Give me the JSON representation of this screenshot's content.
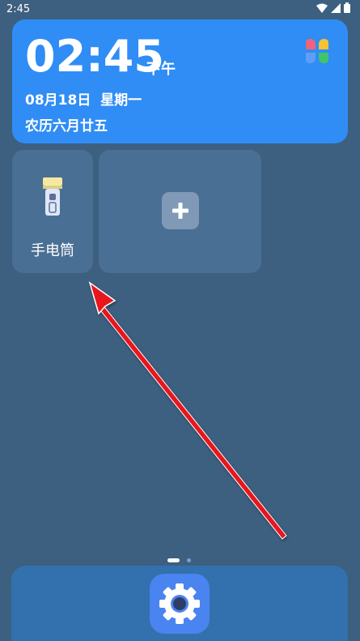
{
  "status_bar": {
    "time": "2:45",
    "icons": [
      "wifi-icon",
      "signal-icon",
      "battery-icon"
    ]
  },
  "clock_widget": {
    "time": "02:45",
    "ampm": "下午",
    "date": "08月18日  星期一",
    "lunar": "农历六月廿五",
    "logo_icon": "four-petal-logo-icon",
    "background_color": "#2f8df5"
  },
  "tiles": {
    "flashlight": {
      "label": "手电筒",
      "icon": "flashlight-icon"
    },
    "add": {
      "icon": "plus-icon"
    }
  },
  "page_indicator": {
    "pages": 2,
    "current": 1
  },
  "dock": {
    "apps": [
      {
        "name": "settings",
        "icon": "gear-icon",
        "color": "#4a84f0"
      }
    ]
  },
  "annotation": {
    "type": "arrow",
    "color": "#e8121a",
    "points_to": "flashlight-tile"
  }
}
